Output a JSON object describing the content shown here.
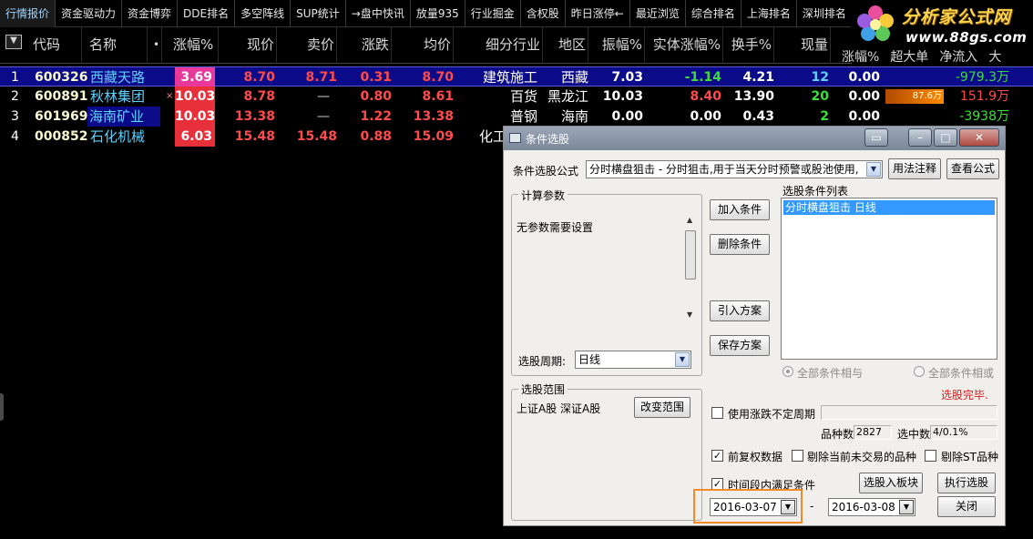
{
  "tabs": [
    "行情报价",
    "资金驱动力",
    "资金博弈",
    "DDE排名",
    "多空阵线",
    "SUP统计",
    "→盘中快讯",
    "放量935",
    "行业掘金",
    "含权股",
    "昨日涨停←",
    "最近浏览",
    "综合排名",
    "上海排名",
    "深圳排名"
  ],
  "logo": {
    "brand": "分析家公式网",
    "url": "www.88gs.com"
  },
  "header": {
    "menu_glyph": "▼",
    "code": "代码",
    "name": "名称",
    "dot": "•",
    "change_pct": "涨幅%",
    "price": "现价",
    "ask": "卖价",
    "change": "涨跌",
    "avg": "均价",
    "industry": "细分行业",
    "region": "地区",
    "amplitude": "振幅%",
    "body_pct": "实体涨幅%",
    "turnover": "换手%",
    "volume": "现量",
    "sub": [
      "涨幅%",
      "超大单",
      "净流入",
      "大"
    ]
  },
  "rows": [
    {
      "idx": "1",
      "code": "600326",
      "name": "西藏天路",
      "mark": "",
      "chg_pct": "3.69",
      "price": "8.70",
      "ask": "8.71",
      "chg": "0.31",
      "avg": "8.70",
      "industry": "建筑施工",
      "region": "西藏",
      "amp": "7.03",
      "body": "-1.14",
      "turnover": "4.21",
      "vol": "12",
      "spd": "0.00",
      "big": "",
      "flow": "-979.3万"
    },
    {
      "idx": "2",
      "code": "600891",
      "name": "秋林集团",
      "mark": "×",
      "chg_pct": "10.03",
      "price": "8.78",
      "ask": "—",
      "chg": "0.80",
      "avg": "8.61",
      "industry": "百货",
      "region": "黑龙江",
      "amp": "10.03",
      "body": "8.40",
      "turnover": "13.90",
      "vol": "20",
      "spd": "0.00",
      "big": "87.6万",
      "flow": "151.9万"
    },
    {
      "idx": "3",
      "code": "601969",
      "name": "海南矿业",
      "mark": "",
      "chg_pct": "10.03",
      "price": "13.38",
      "ask": "—",
      "chg": "1.22",
      "avg": "13.38",
      "industry": "普钢",
      "region": "海南",
      "amp": "0.00",
      "body": "0.00",
      "turnover": "0.43",
      "vol": "2",
      "spd": "0.00",
      "big": "",
      "flow": "-3938万"
    },
    {
      "idx": "4",
      "code": "000852",
      "name": "石化机械",
      "mark": "",
      "chg_pct": "6.03",
      "price": "15.48",
      "ask": "15.48",
      "chg": "0.88",
      "avg": "15.09",
      "industry": "化工",
      "region": "",
      "amp": "",
      "body": "",
      "turnover": "",
      "vol": "",
      "spd": "",
      "big": "",
      "flow": ""
    }
  ],
  "dialog": {
    "title": "条件选股",
    "formula_label": "条件选股公式",
    "formula_value": "分时横盘狙击 - 分时狙击,用于当天分时预警或股池使用,",
    "usage_btn": "用法注释",
    "view_btn": "查看公式",
    "params_group": "计算参数",
    "params_text": "无参数需要设置",
    "add_btn": "加入条件",
    "del_btn": "删除条件",
    "import_btn": "引入方案",
    "save_btn": "保存方案",
    "cond_list_label": "选股条件列表",
    "cond_items": [
      "分时横盘狙击  日线"
    ],
    "period_label": "选股周期:",
    "period_value": "日线",
    "radio_and": "全部条件相与",
    "radio_or": "全部条件相或",
    "status": "选股完毕.",
    "range_group": "选股范围",
    "range_text": "上证A股 深证A股",
    "change_range_btn": "改变范围",
    "use_uncertain": "使用涨跌不定周期",
    "count_label": "品种数",
    "count_value": "2827",
    "selected_label": "选中数",
    "selected_value": "4/0.1%",
    "pre_adjust": "前复权数据",
    "exclude_untraded": "剔除当前未交易的品种",
    "exclude_st": "剔除ST品种",
    "time_range": "时间段内满足条件",
    "to_board_btn": "选股入板块",
    "run_btn": "执行选股",
    "date_from": "2016-03-07",
    "date_sep": "-",
    "date_to": "2016-03-08",
    "close_btn": "关闭"
  },
  "colors": {
    "up": "#ff4b4b",
    "down": "#3adf3a",
    "selection": "#0b0b8a",
    "highlight": "#f08a2b"
  }
}
